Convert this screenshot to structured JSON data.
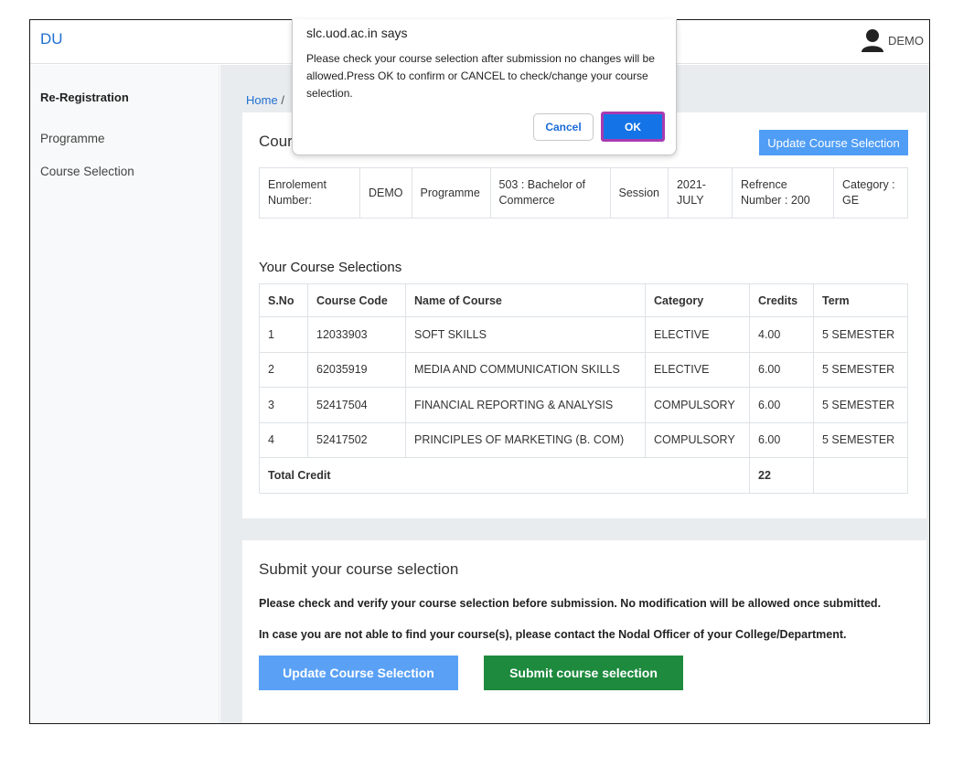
{
  "app": {
    "brand": "DU",
    "user": "DEMO"
  },
  "sidebar": {
    "heading": "Re-Registration",
    "items": [
      {
        "label": "Programme"
      },
      {
        "label": "Course Selection"
      }
    ]
  },
  "breadcrumb": {
    "home": "Home",
    "separator": "/"
  },
  "card1": {
    "title": "Cour",
    "update_button": "Update Course Selection"
  },
  "info": {
    "enrolment_label": "Enrolement Number:",
    "enrolment_value": "DEMO",
    "programme_label": "Programme",
    "programme_value": "503 : Bachelor of Commerce",
    "session_label": "Session",
    "session_value": "2021-JULY",
    "reference": "Refrence Number : 200",
    "category": "Category : GE"
  },
  "courses": {
    "title": "Your Course Selections",
    "headers": [
      "S.No",
      "Course Code",
      "Name of Course",
      "Category",
      "Credits",
      "Term"
    ],
    "rows": [
      [
        "1",
        "12033903",
        "SOFT SKILLS",
        "ELECTIVE",
        "4.00",
        "5 SEMESTER"
      ],
      [
        "2",
        "62035919",
        "MEDIA AND COMMUNICATION SKILLS",
        "ELECTIVE",
        "6.00",
        "5 SEMESTER"
      ],
      [
        "3",
        "52417504",
        "FINANCIAL REPORTING & ANALYSIS",
        "COMPULSORY",
        "6.00",
        "5 SEMESTER"
      ],
      [
        "4",
        "52417502",
        "PRINCIPLES OF MARKETING (B. COM)",
        "COMPULSORY",
        "6.00",
        "5 SEMESTER"
      ]
    ],
    "total_label": "Total Credit",
    "total_value": "22"
  },
  "submit_section": {
    "title": "Submit your course selection",
    "note1": "Please check and verify your course selection before submission. No modification will be allowed once submitted.",
    "note2": "In case you are not able to find your course(s), please contact the Nodal Officer of your College/Department.",
    "update_button": "Update Course Selection",
    "submit_button": "Submit course selection"
  },
  "dialog": {
    "title": "slc.uod.ac.in says",
    "message": "Please check your course selection after submission no changes will be allowed.Press OK to confirm or CANCEL to check/change your course selection.",
    "cancel": "Cancel",
    "ok": "OK"
  },
  "icons": {
    "avatar": "user-avatar-icon"
  },
  "colors": {
    "brand": "#1f6fd1",
    "primary_button": "#4f9df5",
    "submit_button": "#1e8a3e",
    "ok_button": "#1473e6",
    "focus_ring": "#a83bb0"
  }
}
